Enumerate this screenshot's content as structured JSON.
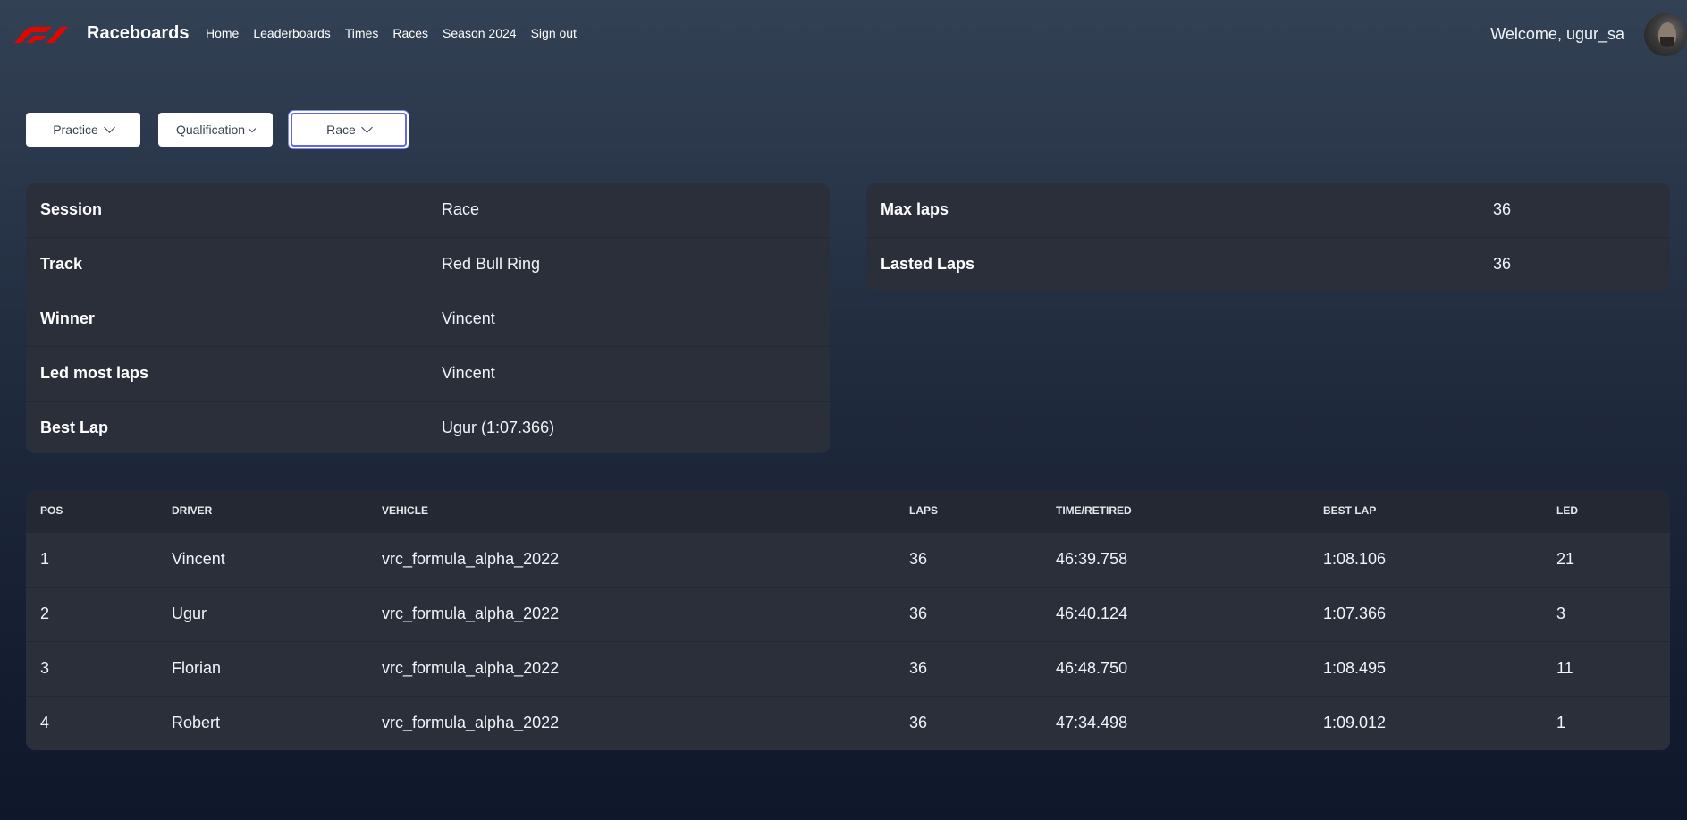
{
  "app": {
    "brand": "Raceboards",
    "logo_icon": "f1-logo-icon",
    "accent": "#e10600"
  },
  "nav": {
    "items": [
      "Home",
      "Leaderboards",
      "Times",
      "Races",
      "Season 2024",
      "Sign out"
    ]
  },
  "user": {
    "welcome": "Welcome, ugur_sa"
  },
  "session_selector": {
    "practice": "Practice",
    "qualification": "Qualification",
    "race": "Race",
    "active": "Race"
  },
  "session_info": [
    {
      "label": "Session",
      "value": "Race"
    },
    {
      "label": "Track",
      "value": "Red Bull Ring"
    },
    {
      "label": "Winner",
      "value": "Vincent"
    },
    {
      "label": "Led most laps",
      "value": "Vincent"
    },
    {
      "label": "Best Lap",
      "value": "Ugur (1:07.366)"
    }
  ],
  "laps_info": [
    {
      "label": "Max laps",
      "value": "36"
    },
    {
      "label": "Lasted Laps",
      "value": "36"
    }
  ],
  "results": {
    "headers": {
      "pos": "POS",
      "driver": "DRIVER",
      "vehicle": "VEHICLE",
      "laps": "LAPS",
      "time": "TIME/RETIRED",
      "best": "BEST LAP",
      "led": "LED"
    },
    "rows": [
      {
        "pos": "1",
        "driver": "Vincent",
        "vehicle": "vrc_formula_alpha_2022",
        "laps": "36",
        "time": "46:39.758",
        "best": "1:08.106",
        "led": "21"
      },
      {
        "pos": "2",
        "driver": "Ugur",
        "vehicle": "vrc_formula_alpha_2022",
        "laps": "36",
        "time": "46:40.124",
        "best": "1:07.366",
        "led": "3"
      },
      {
        "pos": "3",
        "driver": "Florian",
        "vehicle": "vrc_formula_alpha_2022",
        "laps": "36",
        "time": "46:48.750",
        "best": "1:08.495",
        "led": "11"
      },
      {
        "pos": "4",
        "driver": "Robert",
        "vehicle": "vrc_formula_alpha_2022",
        "laps": "36",
        "time": "47:34.498",
        "best": "1:09.012",
        "led": "1"
      }
    ]
  }
}
